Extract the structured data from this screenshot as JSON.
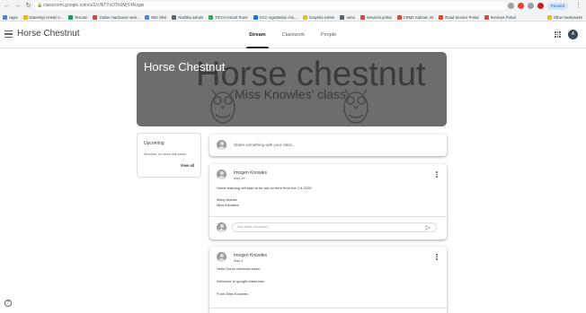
{
  "browser": {
    "url": "classroom.google.com/u/2/c/NTYxOTk0MjY4Nzgw",
    "profile_label": "Paused",
    "bookmarks": [
      {
        "label": "Apps",
        "color": "#4285f4"
      },
      {
        "label": "Daneshyi Hostel 3...",
        "color": "#f4b400"
      },
      {
        "label": "Tescom",
        "color": "#0f9d58"
      },
      {
        "label": "Online Hardcover web...",
        "color": "#db4437"
      },
      {
        "label": "MIS Shel",
        "color": "#4285f4"
      },
      {
        "label": "Rashba solutio",
        "color": "#5f6368"
      },
      {
        "label": "TICCH Smart Tours",
        "color": "#34a853"
      },
      {
        "label": "VCC registration che...",
        "color": "#1a73e8"
      },
      {
        "label": "Graysha Admin",
        "color": "#fbbc04"
      },
      {
        "label": "rama",
        "color": "#5f6368"
      },
      {
        "label": "Services portal",
        "color": "#ea4335"
      },
      {
        "label": "CRMC Kidman Int",
        "color": "#ea4335"
      },
      {
        "label": "Road Service Portal",
        "color": "#ea4335"
      },
      {
        "label": "Services Portal",
        "color": "#ea4335"
      }
    ],
    "other_bookmarks": "Other bookmarks"
  },
  "header": {
    "class_name": "Horse Chestnut",
    "tabs": [
      {
        "label": "Stream"
      },
      {
        "label": "Classwork"
      },
      {
        "label": "People"
      }
    ],
    "avatar_letter": "A"
  },
  "banner": {
    "title": "Horse Chestnut",
    "big_text": "Horse chestnut",
    "sub_text": "Miss Knowles' class"
  },
  "upcoming": {
    "title": "Upcoming",
    "text": "Woohoo, no work due soon!",
    "view_all": "View all"
  },
  "share": {
    "placeholder": "Share something with your class..."
  },
  "posts": [
    {
      "author": "Imogen Knowles",
      "date": "May 26",
      "lines": [
        "Home learning will start to be put on here from the 1.6.2020",
        "",
        "Many thanks",
        "Miss Knowles"
      ],
      "comment_placeholder": "Add class comment..."
    },
    {
      "author": "Imogen Knowles",
      "date": "May 6",
      "lines": [
        "Hello Horse chestnut class!",
        "",
        "Welcome to google classroom",
        "",
        "From Miss Knowles"
      ]
    }
  ]
}
